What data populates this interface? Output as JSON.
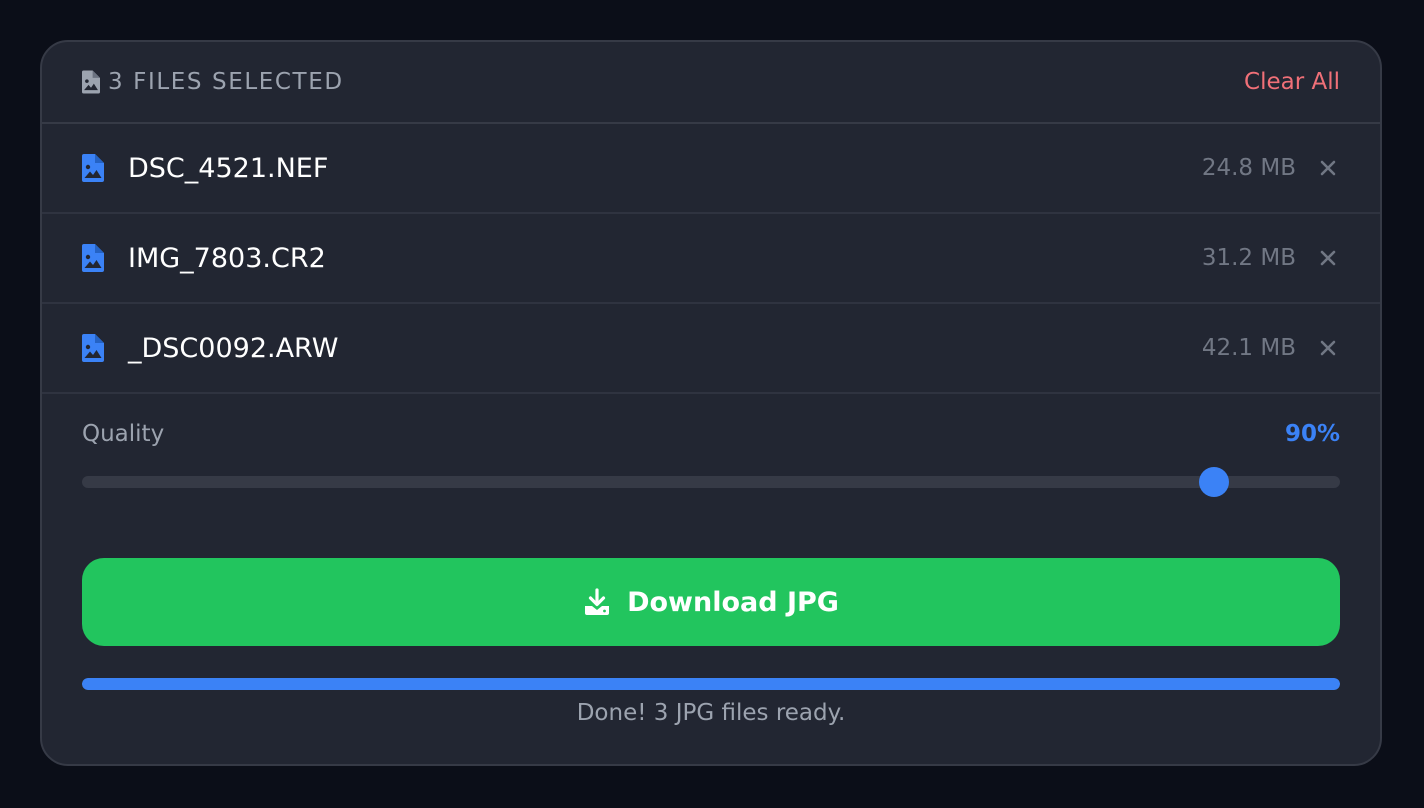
{
  "header": {
    "title": "3 FILES SELECTED",
    "icon": "file-image-icon",
    "clear_label": "Clear All"
  },
  "files": [
    {
      "name": "DSC_4521.NEF",
      "size": "24.8 MB",
      "icon": "file-image-icon"
    },
    {
      "name": "IMG_7803.CR2",
      "size": "31.2 MB",
      "icon": "file-image-icon"
    },
    {
      "name": "_DSC0092.ARW",
      "size": "42.1 MB",
      "icon": "file-image-icon"
    }
  ],
  "quality": {
    "label": "Quality",
    "value_text": "90%",
    "value": 90
  },
  "download": {
    "label": "Download JPG",
    "icon": "download-icon"
  },
  "progress": {
    "value": 100,
    "status": "Done! 3 JPG files ready."
  },
  "colors": {
    "accent": "#3b82f6",
    "success": "#22c55e",
    "danger": "#f07078",
    "background": "#0b0e18",
    "panel": "#222632"
  }
}
